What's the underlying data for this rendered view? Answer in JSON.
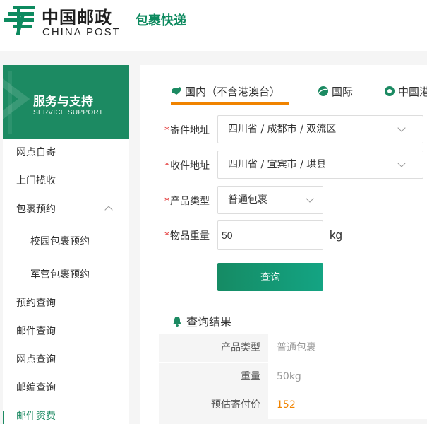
{
  "header": {
    "logo_cn": "中国邮政",
    "logo_en": "CHINA POST",
    "service": "包裹快递",
    "brand_color": "#0d8a5f"
  },
  "sidebar": {
    "title": "服务与支持",
    "subtitle": "SERVICE SUPPORT",
    "items": [
      {
        "label": "网点自寄"
      },
      {
        "label": "上门揽收"
      },
      {
        "label": "包裹预约",
        "expanded": true
      },
      {
        "label": "校园包裹预约"
      },
      {
        "label": "军营包裹预约"
      },
      {
        "label": "预约查询"
      },
      {
        "label": "邮件查询"
      },
      {
        "label": "网点查询"
      },
      {
        "label": "邮编查询"
      },
      {
        "label": "邮件资费",
        "active": true
      }
    ]
  },
  "tabs": [
    {
      "label": "国内（不含港澳台）",
      "icon": "china-map-icon",
      "active": true
    },
    {
      "label": "国际",
      "icon": "globe-icon"
    },
    {
      "label": "中国港",
      "icon": "hongkong-icon"
    }
  ],
  "form": {
    "from_label": "寄件地址",
    "from_value": "四川省 / 成都市 / 双流区",
    "to_label": "收件地址",
    "to_value": "四川省 / 宜宾市 / 珙县",
    "product_label": "产品类型",
    "product_value": "普通包裹",
    "weight_label": "物品重量",
    "weight_value": "50",
    "weight_unit": "kg",
    "required_mark": "*",
    "submit_label": "查询"
  },
  "result": {
    "title": "查询结果",
    "rows": [
      {
        "label": "产品类型",
        "value": "普通包裹"
      },
      {
        "label": "重量",
        "value": "50kg"
      },
      {
        "label": "预估寄付价",
        "value": "152"
      }
    ]
  },
  "colors": {
    "accent": "#1c8a62",
    "tab_underline": "#f08300",
    "price": "#f08300",
    "required": "#e02020"
  }
}
